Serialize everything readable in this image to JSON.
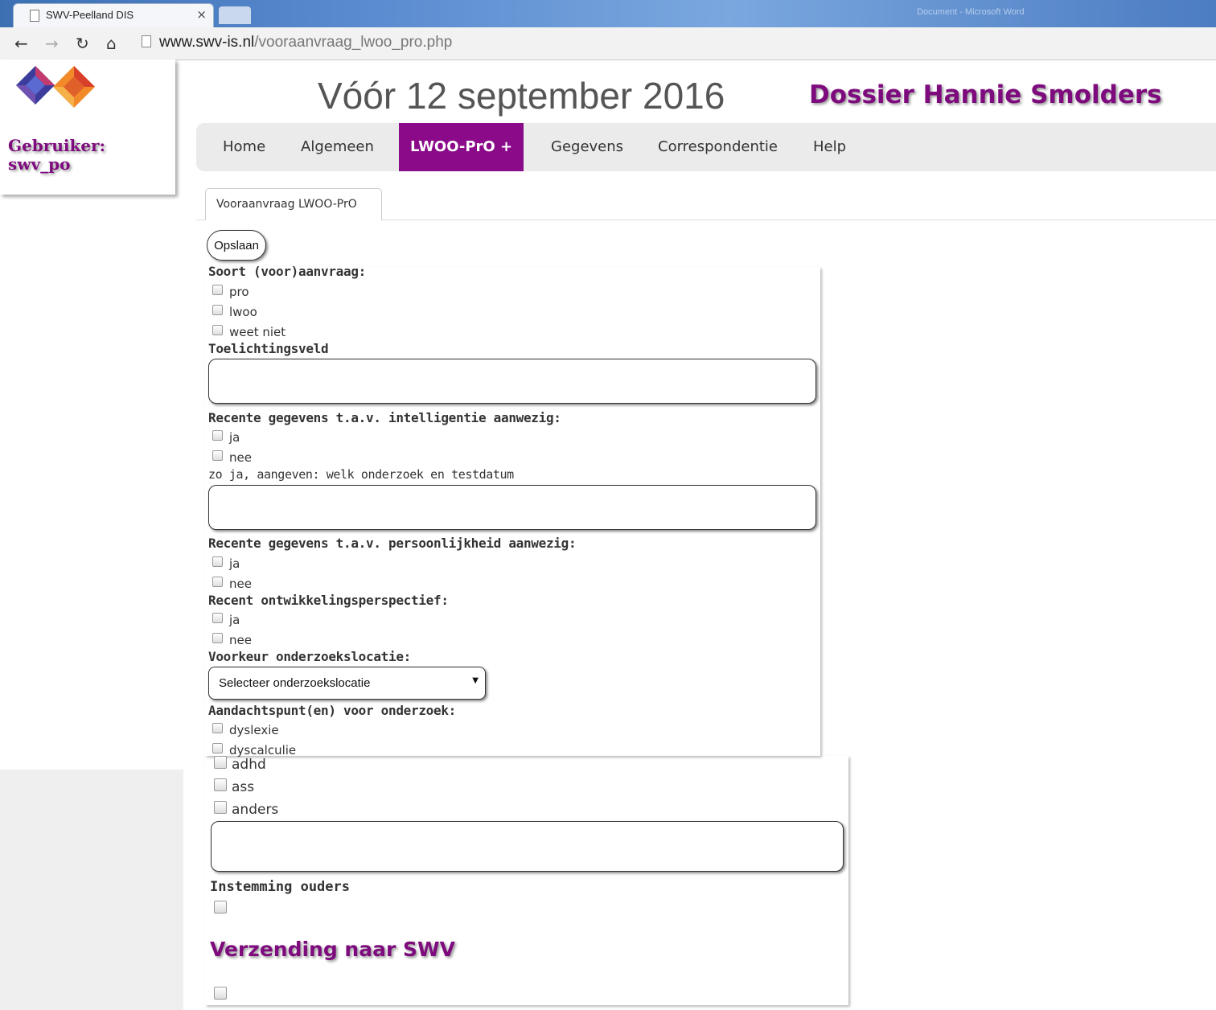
{
  "browser": {
    "tab_title": "SWV-Peelland DIS",
    "tab_close": "×",
    "window_info": "Document - Microsoft Word",
    "url_host": "www.swv-is.nl",
    "url_path": "/vooraanvraag_lwoo_pro.php"
  },
  "sidebar": {
    "user_label": "Gebruiker:",
    "user_name": "swv_po"
  },
  "header": {
    "deadline": "Vóór 12 september 2016",
    "dossier": "Dossier Hannie Smolders"
  },
  "menu": {
    "items": [
      {
        "label": "Home"
      },
      {
        "label": "Algemeen"
      },
      {
        "label": "LWOO-PrO +"
      },
      {
        "label": "Gegevens"
      },
      {
        "label": "Correspondentie"
      },
      {
        "label": "Help"
      }
    ],
    "active": "LWOO-PrO +"
  },
  "subtab": {
    "label": "Vooraanvraag LWOO-PrO"
  },
  "form": {
    "save": "Opslaan",
    "soort_label": "Soort (voor)aanvraag:",
    "soort_options": [
      "pro",
      "lwoo",
      "weet niet"
    ],
    "toelichting_label": "Toelichtingsveld",
    "intelligentie_label": "Recente gegevens t.a.v. intelligentie aanwezig:",
    "intelligentie_options": [
      "ja",
      "nee"
    ],
    "intelligentie_hint": "zo ja, aangeven: welk onderzoek en testdatum",
    "persoonlijkheid_label": "Recente gegevens t.a.v. persoonlijkheid aanwezig:",
    "persoonlijkheid_options": [
      "ja",
      "nee"
    ],
    "ontwikkeling_label": "Recent ontwikkelingsperspectief:",
    "ontwikkeling_options": [
      "ja",
      "nee"
    ],
    "locatie_label": "Voorkeur onderzoekslocatie:",
    "locatie_selected": "Selecteer onderzoekslocatie",
    "aandacht_label": "Aandachtspunt(en) voor onderzoek:",
    "aandacht_options": [
      "dyslexie",
      "dyscalculie",
      "adhd",
      "ass",
      "anders"
    ],
    "instemming_label": "Instemming ouders",
    "verzending_heading": "Verzending naar SWV"
  }
}
